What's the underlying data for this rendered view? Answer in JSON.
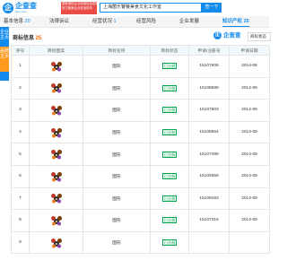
{
  "header": {
    "logo_mark": "企",
    "logo_text": "企查查",
    "logo_sub": "Qcc.com",
    "notice_lines": [
      "国家授权企业信用信息查询平台",
      "官方备案企业征信机构"
    ],
    "search_value": "上海菌乐饕餮美食文化工作室",
    "search_button": "查一下"
  },
  "nav": {
    "tabs": [
      {
        "label": "基本信息",
        "count": "20"
      },
      {
        "label": "法律诉讼",
        "count": ""
      },
      {
        "label": "经营状况",
        "count": "1"
      },
      {
        "label": "经营风险",
        "count": ""
      },
      {
        "label": "企业发展",
        "count": ""
      },
      {
        "label": "知识产权",
        "count": "25"
      }
    ],
    "active_index": 5
  },
  "sidebar": {
    "primary_label": "企业主页",
    "secondary_label": "品牌主页"
  },
  "section": {
    "title": "商标信息",
    "count": "25",
    "status_filter": "商标状态"
  },
  "watermark": {
    "mark": "企",
    "text": "企查查"
  },
  "table": {
    "headers": [
      "序号",
      "商标图案",
      "商标名称",
      "商标状态",
      "申请/注册号",
      "申请日期"
    ],
    "rows": [
      {
        "index": "1",
        "name": "图形",
        "status": "已注册",
        "reg_no": "15107606",
        "date": "2014-08"
      },
      {
        "index": "2",
        "name": "图形",
        "status": "已注册",
        "reg_no": "15108689",
        "date": "2014-08"
      },
      {
        "index": "3",
        "name": "图形",
        "status": "已注册",
        "reg_no": "15107803",
        "date": "2014-08"
      },
      {
        "index": "4",
        "name": "图形",
        "status": "已注册",
        "reg_no": "15108564",
        "date": "2014-08"
      },
      {
        "index": "5",
        "name": "图形",
        "status": "已注册",
        "reg_no": "15107489",
        "date": "2014-08"
      },
      {
        "index": "6",
        "name": "图形",
        "status": "已注册",
        "reg_no": "15109359",
        "date": "2014-08"
      },
      {
        "index": "7",
        "name": "图形",
        "status": "已注册",
        "reg_no": "15109193",
        "date": "2014-08"
      },
      {
        "index": "8",
        "name": "图形",
        "status": "已注册",
        "reg_no": "15107316",
        "date": "2014-08"
      },
      {
        "index": "9",
        "name": "图形",
        "status": "已注册",
        "reg_no": "",
        "date": ""
      }
    ]
  },
  "colors": {
    "brand": "#128bed",
    "notice": "#e94d47",
    "sidebar_secondary": "#ff9a1f",
    "registered": "#00a54f"
  }
}
